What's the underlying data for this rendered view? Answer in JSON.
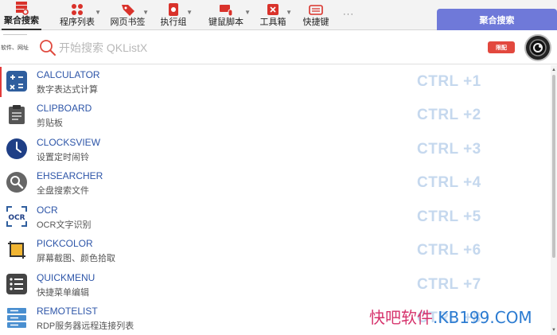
{
  "toolbar": {
    "items": [
      {
        "label": "聚合搜索",
        "icon": "aggregate-search-icon",
        "active": true
      },
      {
        "label": "程序列表",
        "icon": "program-grid-icon",
        "active": false
      },
      {
        "label": "网页书签",
        "icon": "bookmark-tag-icon",
        "active": false
      },
      {
        "label": "执行组",
        "icon": "execute-group-icon",
        "active": false
      },
      {
        "label": "键鼠脚本",
        "icon": "keyboard-mouse-script-icon",
        "active": false
      },
      {
        "label": "工具箱",
        "icon": "toolbox-icon",
        "active": false
      },
      {
        "label": "快捷键",
        "icon": "hotkey-keyboard-icon",
        "active": false
      }
    ],
    "more_label": "···",
    "panel_title": "聚合搜索"
  },
  "search": {
    "hint": "软件、网址",
    "placeholder": "开始搜索 QKListX",
    "value": "",
    "badge": "限配"
  },
  "results": [
    {
      "name": "CALCULATOR",
      "desc": "数字表达式计算",
      "hotkey": "CTRL +1",
      "icon": "calculator-icon"
    },
    {
      "name": "CLIPBOARD",
      "desc": "剪贴板",
      "hotkey": "CTRL +2",
      "icon": "clipboard-icon"
    },
    {
      "name": "CLOCKSVIEW",
      "desc": "设置定时闹铃",
      "hotkey": "CTRL +3",
      "icon": "clock-icon"
    },
    {
      "name": "EHSEARCHER",
      "desc": "全盘搜索文件",
      "hotkey": "CTRL +4",
      "icon": "magnifier-icon"
    },
    {
      "name": "OCR",
      "desc": "OCR文字识别",
      "hotkey": "CTRL +5",
      "icon": "ocr-icon"
    },
    {
      "name": "PICKCOLOR",
      "desc": "屏幕截图、颜色拾取",
      "hotkey": "CTRL +6",
      "icon": "crop-icon"
    },
    {
      "name": "QUICKMENU",
      "desc": "快捷菜单编辑",
      "hotkey": "CTRL +7",
      "icon": "menu-list-icon"
    },
    {
      "name": "REMOTELIST",
      "desc": "RDP服务器远程连接列表",
      "hotkey": "CTRL +8",
      "icon": "server-icon"
    }
  ],
  "watermark": {
    "cn": "快吧软件",
    "en": ".KB199.COM"
  },
  "colors": {
    "accent": "#6f79d9",
    "selected_marker": "#e23a3a",
    "item_name": "#2d55a8",
    "hotkey": "#c5d8ee",
    "badge": "#e2483e"
  }
}
